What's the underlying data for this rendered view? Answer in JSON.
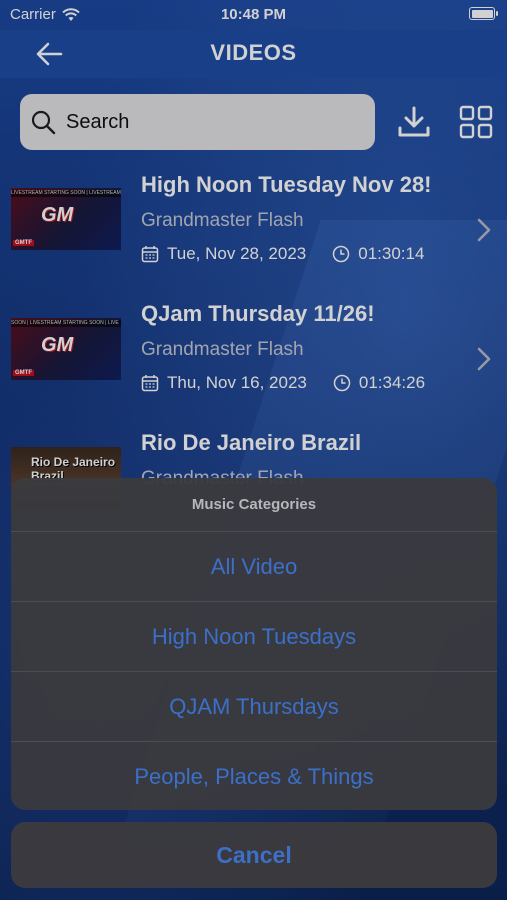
{
  "status": {
    "carrier": "Carrier",
    "time": "10:48 PM"
  },
  "nav": {
    "title": "VIDEOS"
  },
  "search": {
    "placeholder": "Search"
  },
  "videos": [
    {
      "title": "High Noon Tuesday Nov 28!",
      "artist": "Grandmaster Flash",
      "date": "Tue, Nov 28, 2023",
      "duration": "01:30:14",
      "thumb_text": "GM",
      "thumb_strip": "LIVESTREAM STARTING SOON | LIVESTREAM STARTING SOON",
      "thumb_badge": "GMTF"
    },
    {
      "title": "QJam Thursday 11/26!",
      "artist": "Grandmaster Flash",
      "date": "Thu, Nov 16, 2023",
      "duration": "01:34:26",
      "thumb_text": "GM",
      "thumb_strip": "SOON | LIVESTREAM STARTING SOON | LIVE",
      "thumb_badge": "GMTF"
    },
    {
      "title": "Rio De Janeiro Brazil",
      "artist": "Grandmaster Flash",
      "thumb_text": "Rio De Janeiro Brazil"
    }
  ],
  "sheet": {
    "title": "Music Categories",
    "options": [
      "All Video",
      "High Noon Tuesdays",
      "QJAM Thursdays",
      "People, Places & Things"
    ],
    "cancel": "Cancel"
  },
  "colors": {
    "nav_bg": "#1f4ea8",
    "action_blue": "#3c6fc8",
    "sheet_bg": "#3a3a3e"
  }
}
